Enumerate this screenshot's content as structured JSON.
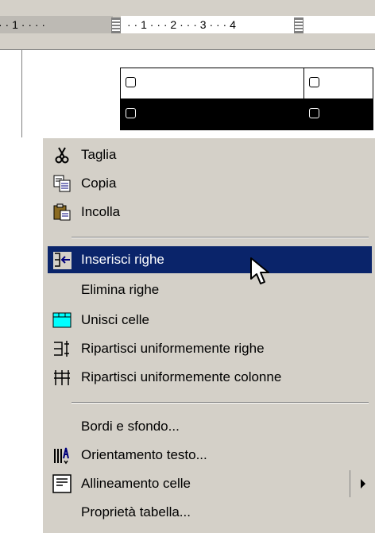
{
  "ruler": {
    "left_marks": "· · 1 · · · · ",
    "right_marks": "· · 1 · · · 2 · · · 3 · · · 4"
  },
  "table": {
    "rows": [
      {
        "cells": [
          "",
          ""
        ],
        "selected": false
      },
      {
        "cells": [
          "",
          ""
        ],
        "selected": true
      }
    ]
  },
  "context_menu": {
    "items": [
      {
        "label": "Taglia",
        "icon": "scissors-icon"
      },
      {
        "label": "Copia",
        "icon": "copy-icon"
      },
      {
        "label": "Incolla",
        "icon": "paste-icon"
      },
      {
        "label": "Inserisci righe",
        "icon": "insert-rows-icon",
        "highlighted": true
      },
      {
        "label": "Elimina righe"
      },
      {
        "label": "Unisci celle",
        "icon": "merge-cells-icon"
      },
      {
        "label": "Ripartisci uniformemente righe",
        "icon": "distribute-rows-icon"
      },
      {
        "label": "Ripartisci uniformemente colonne",
        "icon": "distribute-columns-icon"
      },
      {
        "label": "Bordi e sfondo..."
      },
      {
        "label": "Orientamento testo...",
        "icon": "text-direction-icon"
      },
      {
        "label": "Allineamento celle",
        "icon": "cell-alignment-icon",
        "has_submenu": true
      },
      {
        "label": "Proprietà tabella..."
      }
    ],
    "highlight_color": "#0a246a",
    "background_color": "#d4d0c8"
  }
}
